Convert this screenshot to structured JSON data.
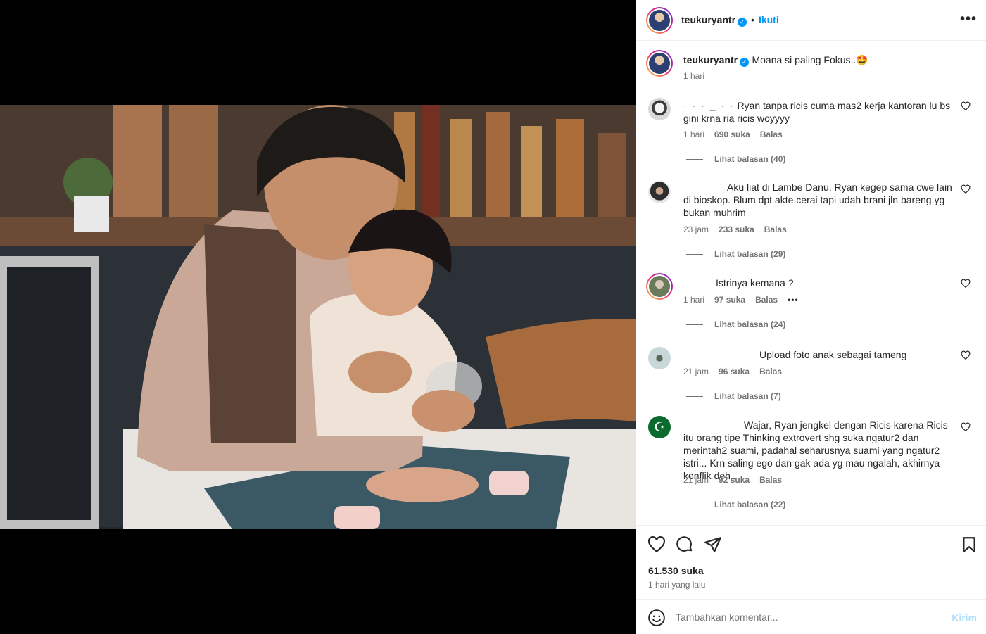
{
  "post": {
    "username": "teukuryantr",
    "follow_label": "Ikuti",
    "dot": "•",
    "more_label": "•••",
    "caption": {
      "username": "teukuryantr",
      "text": "Moana si paling Fokus..🤩",
      "time": "1 hari"
    }
  },
  "comments": [
    {
      "text": "Ryan tanpa ricis cuma mas2 kerja kantoran lu bs gini krna ria ricis woyyyy",
      "time": "1 hari",
      "likes": "690 suka",
      "reply": "Balas",
      "view_replies": "Lihat balasan (40)"
    },
    {
      "text": "Aku liat di Lambe Danu, Ryan kegep sama cwe lain di bioskop. Blum dpt akte cerai tapi udah brani jln bareng yg bukan muhrim",
      "time": "23 jam",
      "likes": "233 suka",
      "reply": "Balas",
      "view_replies": "Lihat balasan (29)"
    },
    {
      "text": "Istrinya kemana ?",
      "time": "1 hari",
      "likes": "97 suka",
      "reply": "Balas",
      "more": "•••",
      "view_replies": "Lihat balasan (24)"
    },
    {
      "text": "Upload foto anak sebagai tameng",
      "time": "21 jam",
      "likes": "96 suka",
      "reply": "Balas",
      "view_replies": "Lihat balasan (7)"
    },
    {
      "text": "Wajar, Ryan jengkel dengan Ricis karena Ricis itu orang tipe Thinking extrovert shg suka ngatur2 dan merintah2 suami, padahal seharusnya suami yang ngatur2 istri... Krn saling ego dan gak ada yg mau ngalah, akhirnya konflik deh..",
      "time": "21 jam",
      "likes": "92 suka",
      "reply": "Balas",
      "view_replies": "Lihat balasan (22)"
    }
  ],
  "stats": {
    "likes": "61.530 suka",
    "posted": "1 hari yang lalu"
  },
  "add_comment": {
    "placeholder": "Tambahkan komentar...",
    "send_label": "Kirim"
  },
  "colors": {
    "accent": "#0095f6",
    "muted": "#737373",
    "send_disabled": "#b2dffc"
  }
}
